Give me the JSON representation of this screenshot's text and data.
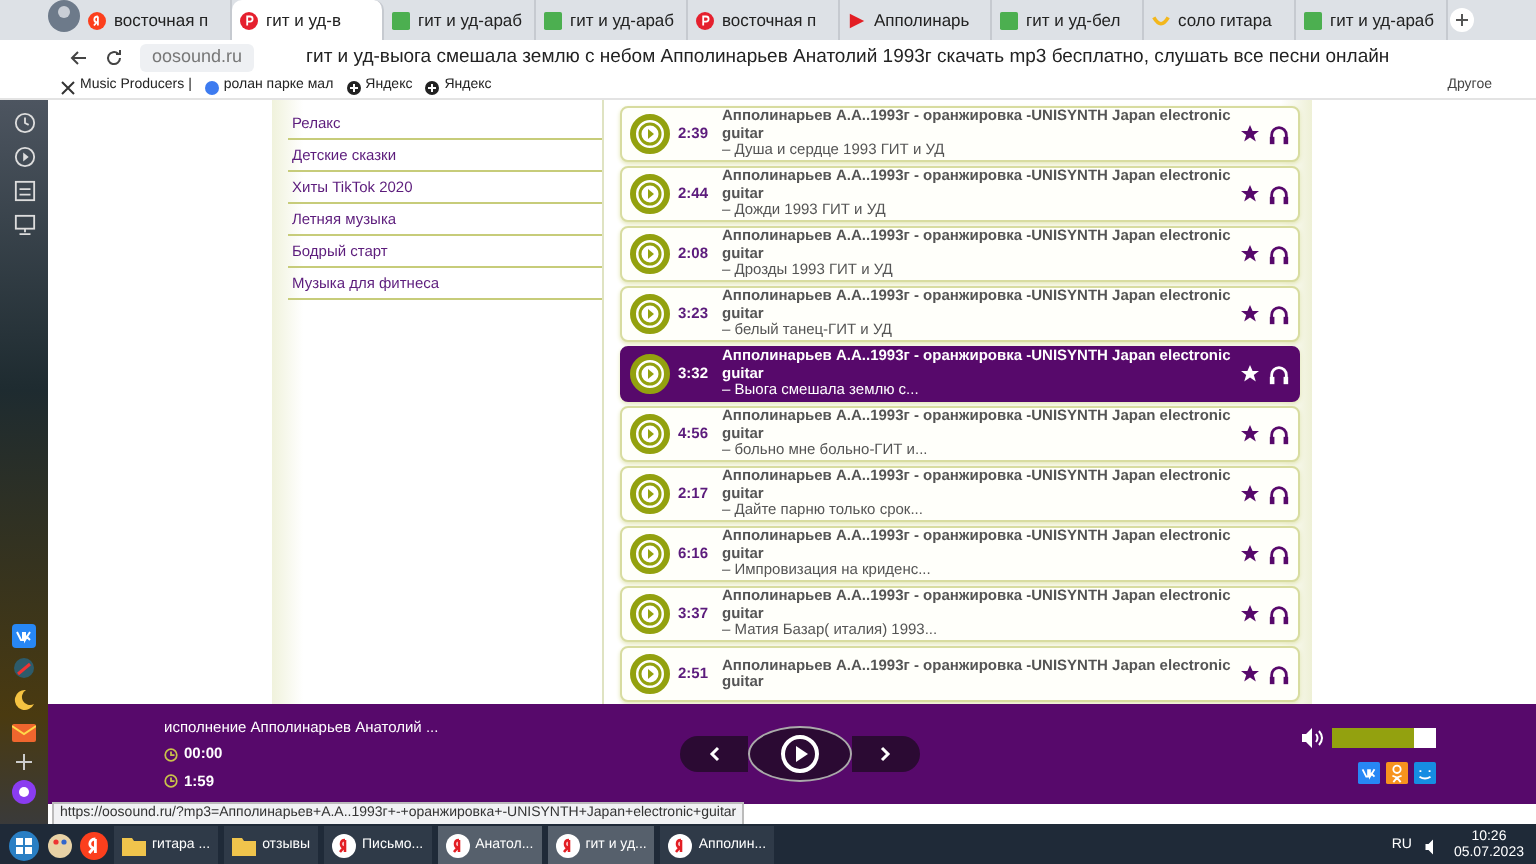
{
  "browser": {
    "tabs": [
      {
        "label": "восточная п",
        "kind": "yandex",
        "selected": false
      },
      {
        "label": "гит и уд-в",
        "kind": "p",
        "selected": true
      },
      {
        "label": "гит и уд-араб",
        "kind": "green",
        "selected": false
      },
      {
        "label": "гит и уд-араб",
        "kind": "green",
        "selected": false
      },
      {
        "label": "восточная п",
        "kind": "p",
        "selected": false
      },
      {
        "label": "Апполинарь",
        "kind": "play",
        "selected": false
      },
      {
        "label": "гит и уд-бел",
        "kind": "green",
        "selected": false
      },
      {
        "label": "соло гитара",
        "kind": "smile",
        "selected": false
      },
      {
        "label": "гит и уд-араб",
        "kind": "green",
        "selected": false
      }
    ],
    "domain": "oosound.ru",
    "page_title": "гит и уд-выога смешала землю с небом Апполинарьев Анатолий 1993г скачать mp3 бесплатно, слушать все песни онлайн",
    "bookmarks": [
      {
        "label": "Music Producers |",
        "kind": "app"
      },
      {
        "label": "ролан парке мал",
        "kind": "site"
      },
      {
        "label": "Яндекс",
        "kind": "dark"
      },
      {
        "label": "Яндекс",
        "kind": "dark"
      }
    ],
    "bookmarks_more": "Другое"
  },
  "menu": [
    "Релакс",
    "Детские сказки",
    "Хиты TikTok 2020",
    "Летняя музыка",
    "Бодрый старт",
    "Музыка для фитнеса"
  ],
  "tracks": [
    {
      "duration": "2:39",
      "title": "Апполинарьев А.А..1993г - оранжировка -UNISYNTH Japan electronic guitar",
      "subtitle": "– Душа и сердце 1993 ГИТ и УД",
      "playing": false
    },
    {
      "duration": "2:44",
      "title": "Апполинарьев А.А..1993г - оранжировка -UNISYNTH Japan electronic guitar",
      "subtitle": "– Дожди 1993 ГИТ и УД",
      "playing": false
    },
    {
      "duration": "2:08",
      "title": "Апполинарьев А.А..1993г - оранжировка -UNISYNTH Japan electronic guitar",
      "subtitle": "– Дрозды 1993 ГИТ и УД",
      "playing": false
    },
    {
      "duration": "3:23",
      "title": "Апполинарьев А.А..1993г - оранжировка -UNISYNTH Japan electronic guitar",
      "subtitle": "– белый танец-ГИТ и УД",
      "playing": false
    },
    {
      "duration": "3:32",
      "title": "Апполинарьев А.А..1993г - оранжировка -UNISYNTH Japan electronic guitar",
      "subtitle": "– Выога смешала землю с...",
      "playing": true
    },
    {
      "duration": "4:56",
      "title": "Апполинарьев А.А..1993г - оранжировка -UNISYNTH Japan electronic guitar",
      "subtitle": "– больно мне больно-ГИТ и...",
      "playing": false
    },
    {
      "duration": "2:17",
      "title": "Апполинарьев А.А..1993г - оранжировка -UNISYNTH Japan electronic guitar",
      "subtitle": "– Дайте парню только срок...",
      "playing": false
    },
    {
      "duration": "6:16",
      "title": "Апполинарьев А.А..1993г - оранжировка -UNISYNTH Japan electronic guitar",
      "subtitle": "– Импровизация на криденс...",
      "playing": false
    },
    {
      "duration": "3:37",
      "title": "Апполинарьев А.А..1993г - оранжировка -UNISYNTH Japan electronic guitar",
      "subtitle": "– Матия Базар( италия) 1993...",
      "playing": false
    },
    {
      "duration": "2:51",
      "title": "Апполинарьев А.А..1993г - оранжировка -UNISYNTH Japan electronic guitar",
      "playing": false
    }
  ],
  "player": {
    "now_playing": "исполнение Апполинарьев Анатолий ...",
    "elapsed": "00:00",
    "total": "1:59",
    "volume": {
      "level": 0.78
    }
  },
  "status_url": "https://oosound.ru/?mp3=Апполинарьев+А.А..1993г+-+оранжировка+-UNISYNTH+Japan+electronic+guitar",
  "taskbar": {
    "windows": [
      {
        "label": "гитара ...",
        "kind": "folder",
        "selected": false
      },
      {
        "label": "отзывы",
        "kind": "folder",
        "selected": false
      },
      {
        "label": "Письмо...",
        "kind": "browser",
        "selected": false
      },
      {
        "label": "Анатол...",
        "kind": "browser",
        "selected": true
      },
      {
        "label": "гит и уд...",
        "kind": "browser",
        "selected": true
      },
      {
        "label": "Апполин...",
        "kind": "browser",
        "selected": false
      }
    ],
    "language": "RU",
    "time": "10:26",
    "date": "05.07.2023"
  }
}
